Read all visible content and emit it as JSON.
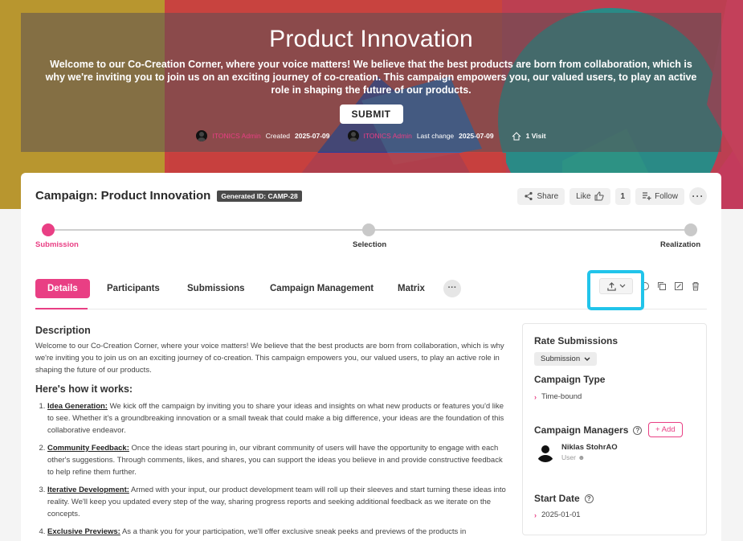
{
  "hero": {
    "title": "Product Innovation",
    "description": "Welcome to our Co-Creation Corner, where your voice matters! We believe that the best products are born from collaboration, which is why we're inviting you to join us on an exciting journey of co-creation. This campaign empowers you, our valued users, to play an active role in shaping the future of our products.",
    "submit_label": "SUBMIT",
    "created_by": "ITONICS Admin",
    "created_label": "Created",
    "created_date": "2025-07-09",
    "changed_by": "ITONICS Admin",
    "changed_label": "Last change",
    "changed_date": "2025-07-09",
    "visits": "1 Visit"
  },
  "header": {
    "title": "Campaign: Product Innovation",
    "generated_id": "Generated ID: CAMP-28",
    "share_label": "Share",
    "like_label": "Like",
    "like_count": "1",
    "follow_label": "Follow"
  },
  "stepper": {
    "steps": [
      "Submission",
      "Selection",
      "Realization"
    ],
    "active_index": 0
  },
  "tabs": [
    "Details",
    "Participants",
    "Submissions",
    "Campaign Management",
    "Matrix"
  ],
  "description": {
    "heading": "Description",
    "text": "Welcome to our Co-Creation Corner, where your voice matters! We believe that the best products are born from collaboration, which is why we're inviting you to join us on an exciting journey of co-creation. This campaign empowers you, our valued users, to play an active role in shaping the future of our products.",
    "how_heading": "Here's how it works:",
    "items": [
      {
        "term": "Idea Generation:",
        "text": " We kick off the campaign by inviting you to share your ideas and insights on what new products or features you'd like to see. Whether it's a groundbreaking innovation or a small tweak that could make a big difference, your ideas are the foundation of this collaborative endeavor."
      },
      {
        "term": "Community Feedback:",
        "text": " Once the ideas start pouring in, our vibrant community of users will have the opportunity to engage with each other's suggestions. Through comments, likes, and shares, you can support the ideas you believe in and provide constructive feedback to help refine them further."
      },
      {
        "term": "Iterative Development:",
        "text": " Armed with your input, our product development team will roll up their sleeves and start turning these ideas into reality. We'll keep you updated every step of the way, sharing progress reports and seeking additional feedback as we iterate on the concepts."
      },
      {
        "term": "Exclusive Previews:",
        "text": " As a thank you for your participation, we'll offer exclusive sneak peeks and previews of the products in"
      }
    ]
  },
  "side": {
    "rate_heading": "Rate Submissions",
    "rate_value": "Submission",
    "type_heading": "Campaign Type",
    "type_value": "Time-bound",
    "managers_heading": "Campaign Managers",
    "add_label": "+ Add",
    "manager_name": "Niklas StohrAO",
    "manager_role": "User",
    "start_heading": "Start Date",
    "start_value": "2025-01-01"
  },
  "colors": {
    "accent": "#e93f84",
    "highlight": "#21c4ea"
  }
}
